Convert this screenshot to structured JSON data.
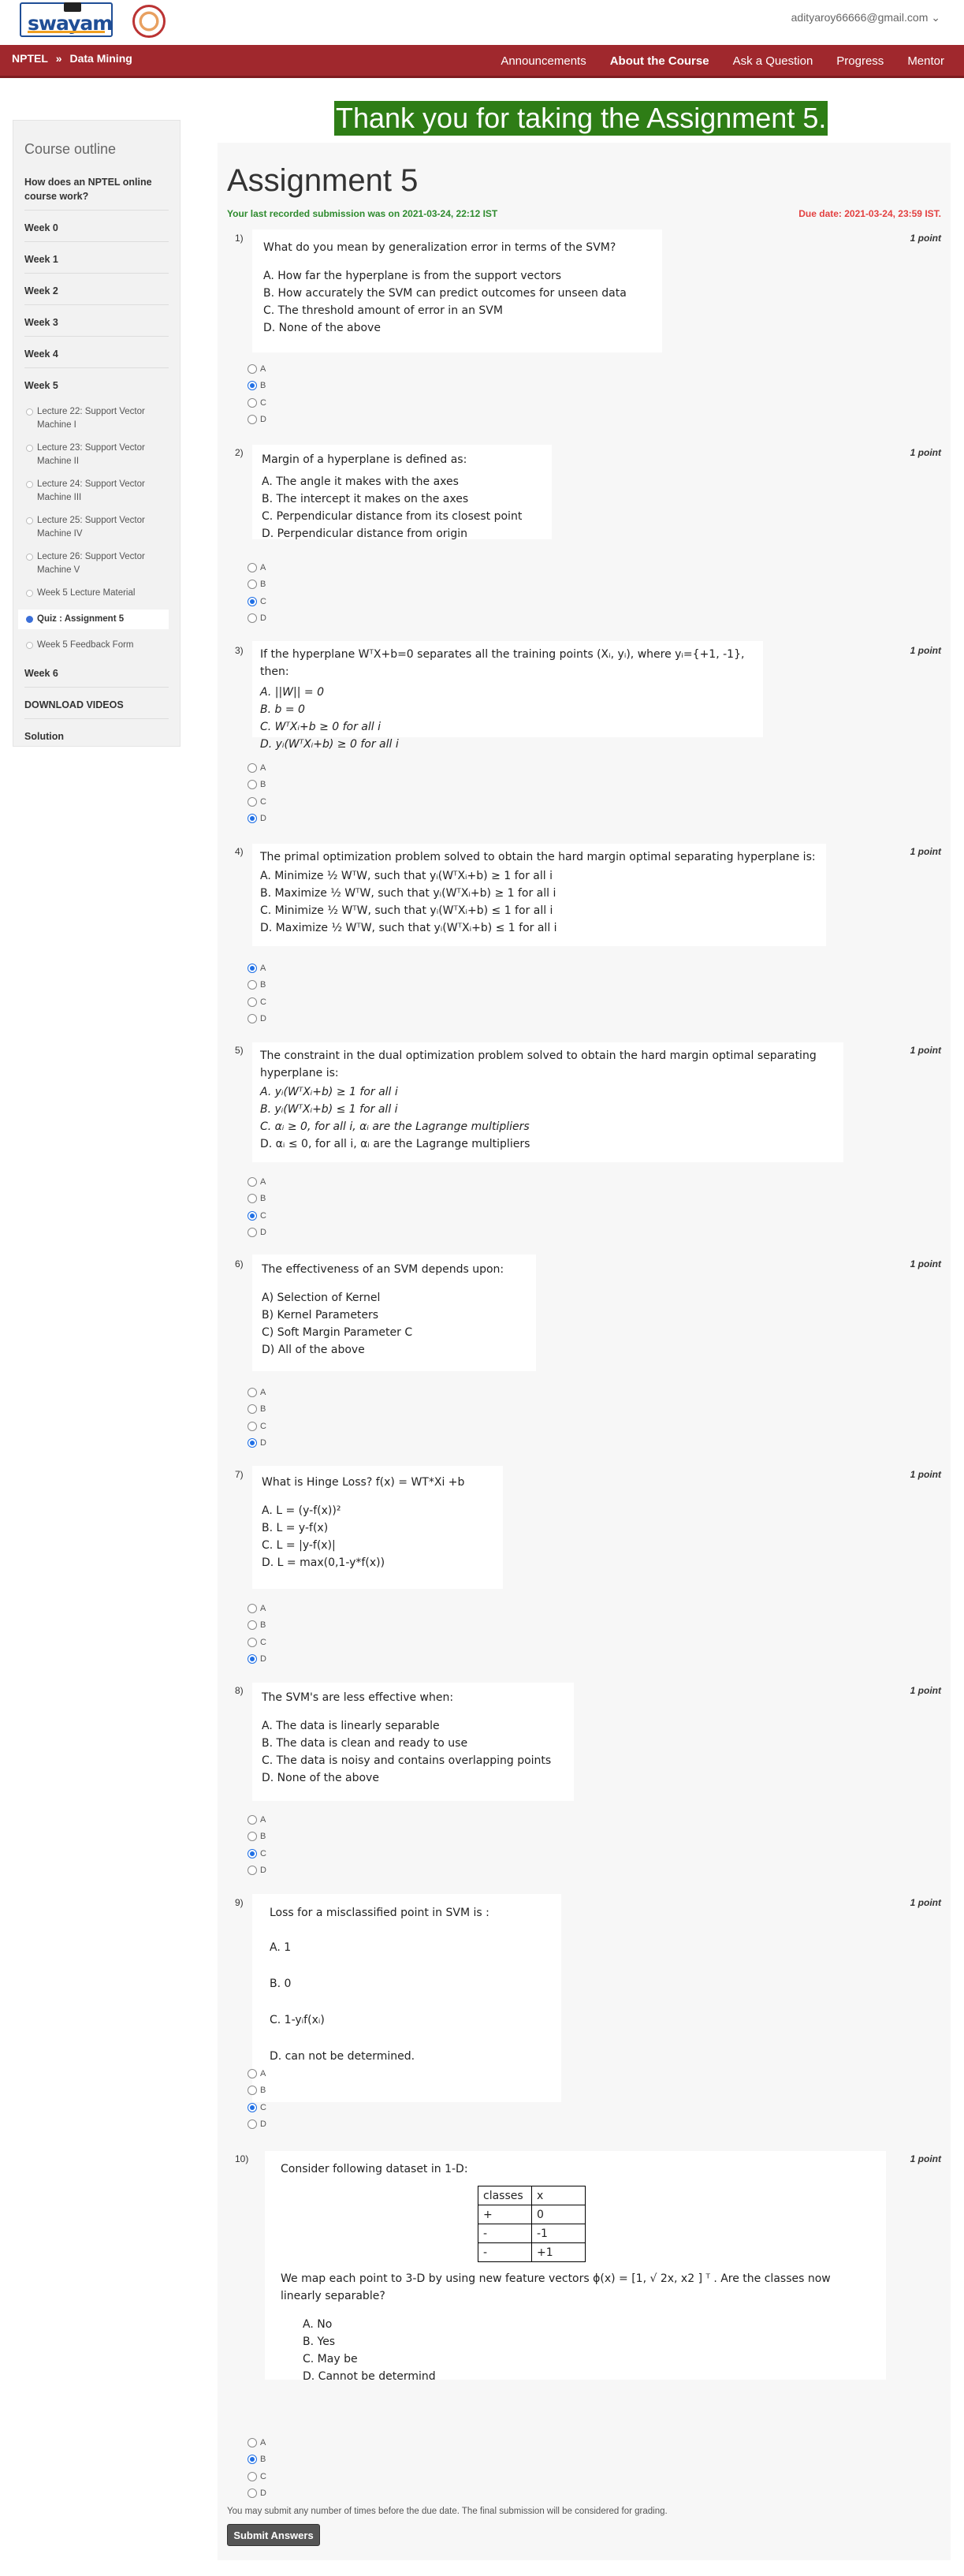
{
  "header": {
    "logo_text": "swayam",
    "user_email": "adityaroy66666@gmail.com ⌄"
  },
  "navbar": {
    "breadcrumb": [
      "NPTEL",
      "»",
      "Data Mining"
    ],
    "links": [
      "Announcements",
      "About the Course",
      "Ask a Question",
      "Progress",
      "Mentor"
    ]
  },
  "sidebar": {
    "title": "Course outline",
    "items": [
      "How does an NPTEL online course work?",
      "Week 0",
      "Week 1",
      "Week 2",
      "Week 3",
      "Week 4",
      "Week 5"
    ],
    "week5_subitems": [
      "Lecture 22: Support Vector Machine I",
      "Lecture 23: Support Vector Machine II",
      "Lecture 24: Support Vector Machine III",
      "Lecture 25: Support Vector Machine IV",
      "Lecture 26: Support Vector Machine V",
      "Week 5 Lecture Material",
      "Quiz : Assignment 5",
      "Week 5 Feedback Form"
    ],
    "after_items": [
      "Week 6",
      "DOWNLOAD VIDEOS",
      "Solution"
    ]
  },
  "main": {
    "thanks_banner": "Thank you for taking the Assignment 5.",
    "title": "Assignment 5",
    "last_submission": "Your last recorded submission was on 2021-03-24, 22:12 IST",
    "due_date": "Due date: 2021-03-24, 23:59 IST.",
    "point_label": "1 point",
    "radio_labels": [
      "A",
      "B",
      "C",
      "D"
    ],
    "footnote": "You may submit any number of times before the due date. The final submission will be considered for grading.",
    "submit_label": "Submit Answers"
  },
  "questions": [
    {
      "num": "1)",
      "stem": "What do you mean by generalization error in terms of the SVM?",
      "options": [
        "A. How far the hyperplane is from the support vectors",
        "B. How accurately the SVM can predict outcomes for unseen data",
        "C. The threshold amount of error in an SVM",
        "D. None of the above"
      ],
      "selected": 1
    },
    {
      "num": "2)",
      "stem": "Margin of a hyperplane is defined as:",
      "options": [
        "A. The angle it makes with the axes",
        "B. The intercept it makes on the axes",
        "C. Perpendicular distance from its closest point",
        "D. Perpendicular distance from origin"
      ],
      "selected": 2
    },
    {
      "num": "3)",
      "stem": "If the hyperplane WᵀX+b=0 separates all the training points (Xᵢ, yᵢ), where yᵢ={+1, -1}, then:",
      "options": [
        "A. ||W|| = 0",
        "B. b = 0",
        "C. WᵀXᵢ+b ≥ 0 for all i",
        "D. yᵢ(WᵀXᵢ+b) ≥ 0 for all i"
      ],
      "selected": 3
    },
    {
      "num": "4)",
      "stem": "The primal optimization problem solved to obtain the hard margin optimal separating hyperplane is:",
      "options": [
        "A. Minimize ½ WᵀW, such that yᵢ(WᵀXᵢ+b) ≥ 1 for all i",
        "B. Maximize ½ WᵀW, such that yᵢ(WᵀXᵢ+b) ≥ 1 for all i",
        "C. Minimize ½ WᵀW, such that yᵢ(WᵀXᵢ+b) ≤ 1 for all i",
        "D. Maximize ½ WᵀW, such that yᵢ(WᵀXᵢ+b) ≤ 1 for all i"
      ],
      "selected": 0
    },
    {
      "num": "5)",
      "stem": "The constraint in the dual optimization problem solved to obtain the hard margin optimal separating hyperplane is:",
      "options": [
        "A. yᵢ(WᵀXᵢ+b) ≥ 1 for all i",
        "B. yᵢ(WᵀXᵢ+b) ≤ 1 for all i",
        "C. αᵢ ≥ 0, for all i, αᵢ are the Lagrange multipliers",
        "D. αᵢ ≤ 0, for all i, αᵢ are the Lagrange multipliers"
      ],
      "selected": 2
    },
    {
      "num": "6)",
      "stem": "The effectiveness of an SVM depends upon:",
      "options": [
        "A) Selection of Kernel",
        "B) Kernel Parameters",
        "C) Soft Margin Parameter C",
        "D) All of the above"
      ],
      "selected": 3
    },
    {
      "num": "7)",
      "stem": "What is Hinge Loss? f(x) = WT*Xi +b",
      "options": [
        "A. L = (y-f(x))²",
        "B. L = y-f(x)",
        "C. L = |y-f(x)|",
        "D.  L = max(0,1-y*f(x))"
      ],
      "selected": 3
    },
    {
      "num": "8)",
      "stem": "The SVM's are less effective when:",
      "options": [
        "A. The data is linearly separable",
        "B. The data is clean and ready to use",
        "C. The data is noisy and contains overlapping points",
        "D. None of the above"
      ],
      "selected": 2
    },
    {
      "num": "9)",
      "stem": "Loss for a misclassified point in SVM is :",
      "options": [
        "A. 1",
        "B. 0",
        "C. 1-yᵢf(xᵢ)",
        "D. can not be determined."
      ],
      "selected": 2
    },
    {
      "num": "10)",
      "stem": "Consider following dataset in 1-D:",
      "table": {
        "headers": [
          "classes",
          "x"
        ],
        "rows": [
          [
            "+",
            "0"
          ],
          [
            "-",
            "-1"
          ],
          [
            "-",
            "+1"
          ]
        ]
      },
      "stem2": "We map each point to 3-D by using new feature vectors ϕ(x) = [1, √ 2x, x2 ] ᵀ . Are the classes now linearly separable?",
      "options": [
        "A.    No",
        "B.    Yes",
        "C.    May be",
        "D.    Cannot be determind"
      ],
      "selected": 1
    }
  ]
}
